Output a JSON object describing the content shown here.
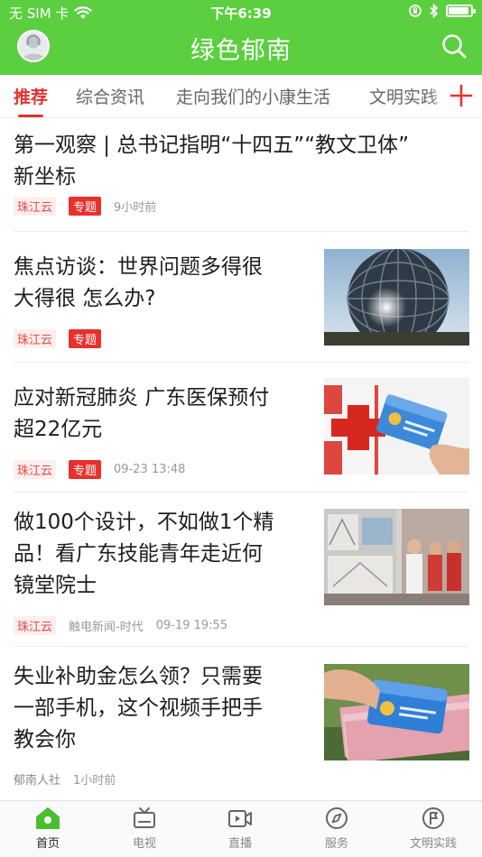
{
  "status": {
    "carrier": "无 SIM 卡",
    "time": "下午6:39",
    "battery_level": 0.9
  },
  "header": {
    "title": "绿色郁南"
  },
  "tabs": [
    {
      "label": "推荐",
      "active": true
    },
    {
      "label": "综合资讯"
    },
    {
      "label": "走向我们的小康生活"
    },
    {
      "label": "文明实践"
    }
  ],
  "news": [
    {
      "title_lines": [
        "第一观察 | 总书记指明“十四五”“教文卫体”",
        "新坐标"
      ],
      "source": "珠江云",
      "tag": "专题",
      "time": "9小时前",
      "thumb": ""
    },
    {
      "title_lines": [
        "焦点访谈：世界问题多得很",
        "大得很 怎么办?"
      ],
      "source": "珠江云",
      "tag": "专题",
      "time": "",
      "thumb": "globe"
    },
    {
      "title_lines": [
        "应对新冠肺炎 广东医保预付",
        "超22亿元"
      ],
      "source": "珠江云",
      "tag": "专题",
      "time": "09-23 13:48",
      "thumb": "medical-card"
    },
    {
      "title_lines": [
        "做100个设计，不如做1个精",
        "品！看广东技能青年走近何",
        "镜堂院士"
      ],
      "source": "珠江云",
      "tag": "",
      "channel": "触电新闻-时代",
      "time": "09-19 19:55",
      "thumb": "exhibition"
    },
    {
      "title_lines": [
        "失业补助金怎么领？只需要",
        "一部手机，这个视频手把手",
        "教会你"
      ],
      "source": "郁南人社",
      "tag": "",
      "time": "1小时前",
      "thumb": "cash-card"
    }
  ],
  "tabbar": [
    {
      "label": "首页",
      "icon": "home-icon",
      "active": true
    },
    {
      "label": "电视",
      "icon": "tv-icon"
    },
    {
      "label": "直播",
      "icon": "live-icon"
    },
    {
      "label": "服务",
      "icon": "compass-icon"
    },
    {
      "label": "文明实践",
      "icon": "flag-icon"
    }
  ],
  "colors": {
    "brand_green": "#5bcf3f",
    "accent_red": "#e8302c"
  }
}
